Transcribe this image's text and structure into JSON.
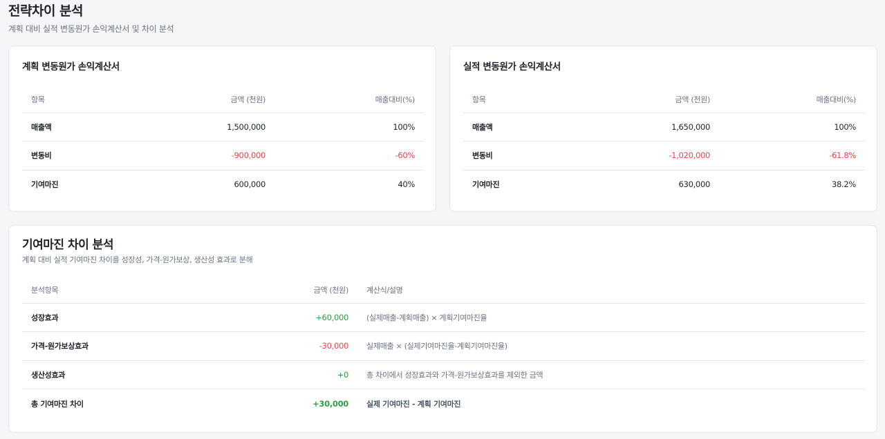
{
  "header": {
    "title": "전략차이 분석",
    "subtitle": "계획 대비 실적 변동원가 손익계산서 및 차이 분석"
  },
  "plan_statement": {
    "title": "계획 변동원가 손익계산서",
    "columns": [
      "항목",
      "금액 (천원)",
      "매출대비(%)"
    ],
    "rows": [
      {
        "item": "매출액",
        "amount": "1,500,000",
        "ratio": "100%",
        "tone": "normal"
      },
      {
        "item": "변동비",
        "amount": "-900,000",
        "ratio": "-60%",
        "tone": "negative"
      },
      {
        "item": "기여마진",
        "amount": "600,000",
        "ratio": "40%",
        "tone": "normal"
      }
    ]
  },
  "actual_statement": {
    "title": "실적 변동원가 손익계산서",
    "columns": [
      "항목",
      "금액 (천원)",
      "매출대비(%)"
    ],
    "rows": [
      {
        "item": "매출액",
        "amount": "1,650,000",
        "ratio": "100%",
        "tone": "normal"
      },
      {
        "item": "변동비",
        "amount": "-1,020,000",
        "ratio": "-61.8%",
        "tone": "negative"
      },
      {
        "item": "기여마진",
        "amount": "630,000",
        "ratio": "38.2%",
        "tone": "normal"
      }
    ]
  },
  "variance_analysis": {
    "title": "기여마진 차이 분석",
    "subtitle": "계획 대비 실적 기여마진 차이를 성장성, 가격-원가보상, 생산성 효과로 분해",
    "columns": [
      "분석항목",
      "금액 (천원)",
      "계산식/설명"
    ],
    "rows": [
      {
        "item": "성장효과",
        "amount": "+60,000",
        "description": "(실제매출-계획매출) × 계획기여마진율",
        "tone": "positive"
      },
      {
        "item": "가격-원가보상효과",
        "amount": "-30,000",
        "description": "실제매출 × (실제기여마진율-계획기여마진율)",
        "tone": "negative"
      },
      {
        "item": "생산성효과",
        "amount": "+0",
        "description": "총 차이에서 성장효과와 가격-원가보상효과를 제외한 금액",
        "tone": "positive"
      },
      {
        "item": "총 기여마진 차이",
        "amount": "+30,000",
        "description": "실제 기여마진 - 계획 기여마진",
        "tone": "total"
      }
    ]
  },
  "colors": {
    "negative": "#e5484d",
    "positive": "#2f9e44",
    "border": "#e4e7eb",
    "background": "#f5f6f8"
  }
}
